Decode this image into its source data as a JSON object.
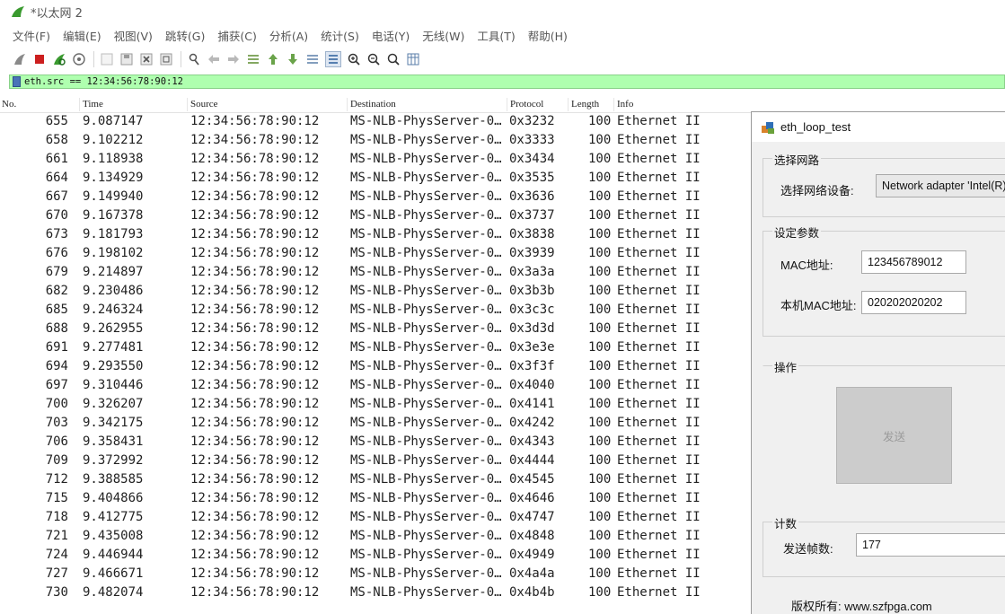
{
  "window": {
    "title": "*以太网 2"
  },
  "menu": [
    "文件(F)",
    "编辑(E)",
    "视图(V)",
    "跳转(G)",
    "捕获(C)",
    "分析(A)",
    "统计(S)",
    "电话(Y)",
    "无线(W)",
    "工具(T)",
    "帮助(H)"
  ],
  "toolbar_icons": [
    "shark-fin-start-icon",
    "stop-capture-icon",
    "restart-capture-icon",
    "capture-options-icon",
    "open-file-icon",
    "save-file-icon",
    "close-file-icon",
    "reload-file-icon",
    "find-packet-icon",
    "go-back-icon",
    "go-forward-icon",
    "go-to-packet-icon",
    "first-packet-icon",
    "last-packet-icon",
    "auto-scroll-icon",
    "colorize-icon",
    "zoom-in-icon",
    "zoom-out-icon",
    "zoom-normal-icon",
    "resize-columns-icon"
  ],
  "filter": {
    "value": "eth.src == 12:34:56:78:90:12"
  },
  "columns": {
    "no": "No.",
    "time": "Time",
    "source": "Source",
    "destination": "Destination",
    "protocol": "Protocol",
    "length": "Length",
    "info": "Info"
  },
  "packets": [
    {
      "no": "655",
      "time": "9.087147",
      "src": "12:34:56:78:90:12",
      "dst": "MS-NLB-PhysServer-0…",
      "proto": "0x3232",
      "len": "100",
      "info": "Ethernet II"
    },
    {
      "no": "658",
      "time": "9.102212",
      "src": "12:34:56:78:90:12",
      "dst": "MS-NLB-PhysServer-0…",
      "proto": "0x3333",
      "len": "100",
      "info": "Ethernet II"
    },
    {
      "no": "661",
      "time": "9.118938",
      "src": "12:34:56:78:90:12",
      "dst": "MS-NLB-PhysServer-0…",
      "proto": "0x3434",
      "len": "100",
      "info": "Ethernet II"
    },
    {
      "no": "664",
      "time": "9.134929",
      "src": "12:34:56:78:90:12",
      "dst": "MS-NLB-PhysServer-0…",
      "proto": "0x3535",
      "len": "100",
      "info": "Ethernet II"
    },
    {
      "no": "667",
      "time": "9.149940",
      "src": "12:34:56:78:90:12",
      "dst": "MS-NLB-PhysServer-0…",
      "proto": "0x3636",
      "len": "100",
      "info": "Ethernet II"
    },
    {
      "no": "670",
      "time": "9.167378",
      "src": "12:34:56:78:90:12",
      "dst": "MS-NLB-PhysServer-0…",
      "proto": "0x3737",
      "len": "100",
      "info": "Ethernet II"
    },
    {
      "no": "673",
      "time": "9.181793",
      "src": "12:34:56:78:90:12",
      "dst": "MS-NLB-PhysServer-0…",
      "proto": "0x3838",
      "len": "100",
      "info": "Ethernet II"
    },
    {
      "no": "676",
      "time": "9.198102",
      "src": "12:34:56:78:90:12",
      "dst": "MS-NLB-PhysServer-0…",
      "proto": "0x3939",
      "len": "100",
      "info": "Ethernet II"
    },
    {
      "no": "679",
      "time": "9.214897",
      "src": "12:34:56:78:90:12",
      "dst": "MS-NLB-PhysServer-0…",
      "proto": "0x3a3a",
      "len": "100",
      "info": "Ethernet II"
    },
    {
      "no": "682",
      "time": "9.230486",
      "src": "12:34:56:78:90:12",
      "dst": "MS-NLB-PhysServer-0…",
      "proto": "0x3b3b",
      "len": "100",
      "info": "Ethernet II"
    },
    {
      "no": "685",
      "time": "9.246324",
      "src": "12:34:56:78:90:12",
      "dst": "MS-NLB-PhysServer-0…",
      "proto": "0x3c3c",
      "len": "100",
      "info": "Ethernet II"
    },
    {
      "no": "688",
      "time": "9.262955",
      "src": "12:34:56:78:90:12",
      "dst": "MS-NLB-PhysServer-0…",
      "proto": "0x3d3d",
      "len": "100",
      "info": "Ethernet II"
    },
    {
      "no": "691",
      "time": "9.277481",
      "src": "12:34:56:78:90:12",
      "dst": "MS-NLB-PhysServer-0…",
      "proto": "0x3e3e",
      "len": "100",
      "info": "Ethernet II"
    },
    {
      "no": "694",
      "time": "9.293550",
      "src": "12:34:56:78:90:12",
      "dst": "MS-NLB-PhysServer-0…",
      "proto": "0x3f3f",
      "len": "100",
      "info": "Ethernet II"
    },
    {
      "no": "697",
      "time": "9.310446",
      "src": "12:34:56:78:90:12",
      "dst": "MS-NLB-PhysServer-0…",
      "proto": "0x4040",
      "len": "100",
      "info": "Ethernet II"
    },
    {
      "no": "700",
      "time": "9.326207",
      "src": "12:34:56:78:90:12",
      "dst": "MS-NLB-PhysServer-0…",
      "proto": "0x4141",
      "len": "100",
      "info": "Ethernet II"
    },
    {
      "no": "703",
      "time": "9.342175",
      "src": "12:34:56:78:90:12",
      "dst": "MS-NLB-PhysServer-0…",
      "proto": "0x4242",
      "len": "100",
      "info": "Ethernet II"
    },
    {
      "no": "706",
      "time": "9.358431",
      "src": "12:34:56:78:90:12",
      "dst": "MS-NLB-PhysServer-0…",
      "proto": "0x4343",
      "len": "100",
      "info": "Ethernet II"
    },
    {
      "no": "709",
      "time": "9.372992",
      "src": "12:34:56:78:90:12",
      "dst": "MS-NLB-PhysServer-0…",
      "proto": "0x4444",
      "len": "100",
      "info": "Ethernet II"
    },
    {
      "no": "712",
      "time": "9.388585",
      "src": "12:34:56:78:90:12",
      "dst": "MS-NLB-PhysServer-0…",
      "proto": "0x4545",
      "len": "100",
      "info": "Ethernet II"
    },
    {
      "no": "715",
      "time": "9.404866",
      "src": "12:34:56:78:90:12",
      "dst": "MS-NLB-PhysServer-0…",
      "proto": "0x4646",
      "len": "100",
      "info": "Ethernet II"
    },
    {
      "no": "718",
      "time": "9.412775",
      "src": "12:34:56:78:90:12",
      "dst": "MS-NLB-PhysServer-0…",
      "proto": "0x4747",
      "len": "100",
      "info": "Ethernet II"
    },
    {
      "no": "721",
      "time": "9.435008",
      "src": "12:34:56:78:90:12",
      "dst": "MS-NLB-PhysServer-0…",
      "proto": "0x4848",
      "len": "100",
      "info": "Ethernet II"
    },
    {
      "no": "724",
      "time": "9.446944",
      "src": "12:34:56:78:90:12",
      "dst": "MS-NLB-PhysServer-0…",
      "proto": "0x4949",
      "len": "100",
      "info": "Ethernet II"
    },
    {
      "no": "727",
      "time": "9.466671",
      "src": "12:34:56:78:90:12",
      "dst": "MS-NLB-PhysServer-0…",
      "proto": "0x4a4a",
      "len": "100",
      "info": "Ethernet II"
    },
    {
      "no": "730",
      "time": "9.482074",
      "src": "12:34:56:78:90:12",
      "dst": "MS-NLB-PhysServer-0…",
      "proto": "0x4b4b",
      "len": "100",
      "info": "Ethernet II"
    }
  ],
  "dialog": {
    "title": "eth_loop_test",
    "group_network": "选择网路",
    "device_label": "选择网络设备:",
    "device_value": "Network adapter 'Intel(R)",
    "group_params": "设定参数",
    "mac_label": "MAC地址:",
    "mac_value": "123456789012",
    "local_mac_label": "本机MAC地址:",
    "local_mac_value": "020202020202",
    "group_ops": "操作",
    "send_label": "发送",
    "group_count": "计数",
    "frames_label": "发送帧数:",
    "frames_value": "177",
    "copyright": "版权所有: www.szfpga.com"
  },
  "colors": {
    "filter_bg": "#afffaf",
    "dialog_bg": "#f0f0f0",
    "stop_red": "#cc1f1f",
    "shark_green": "#3a9a2f"
  }
}
